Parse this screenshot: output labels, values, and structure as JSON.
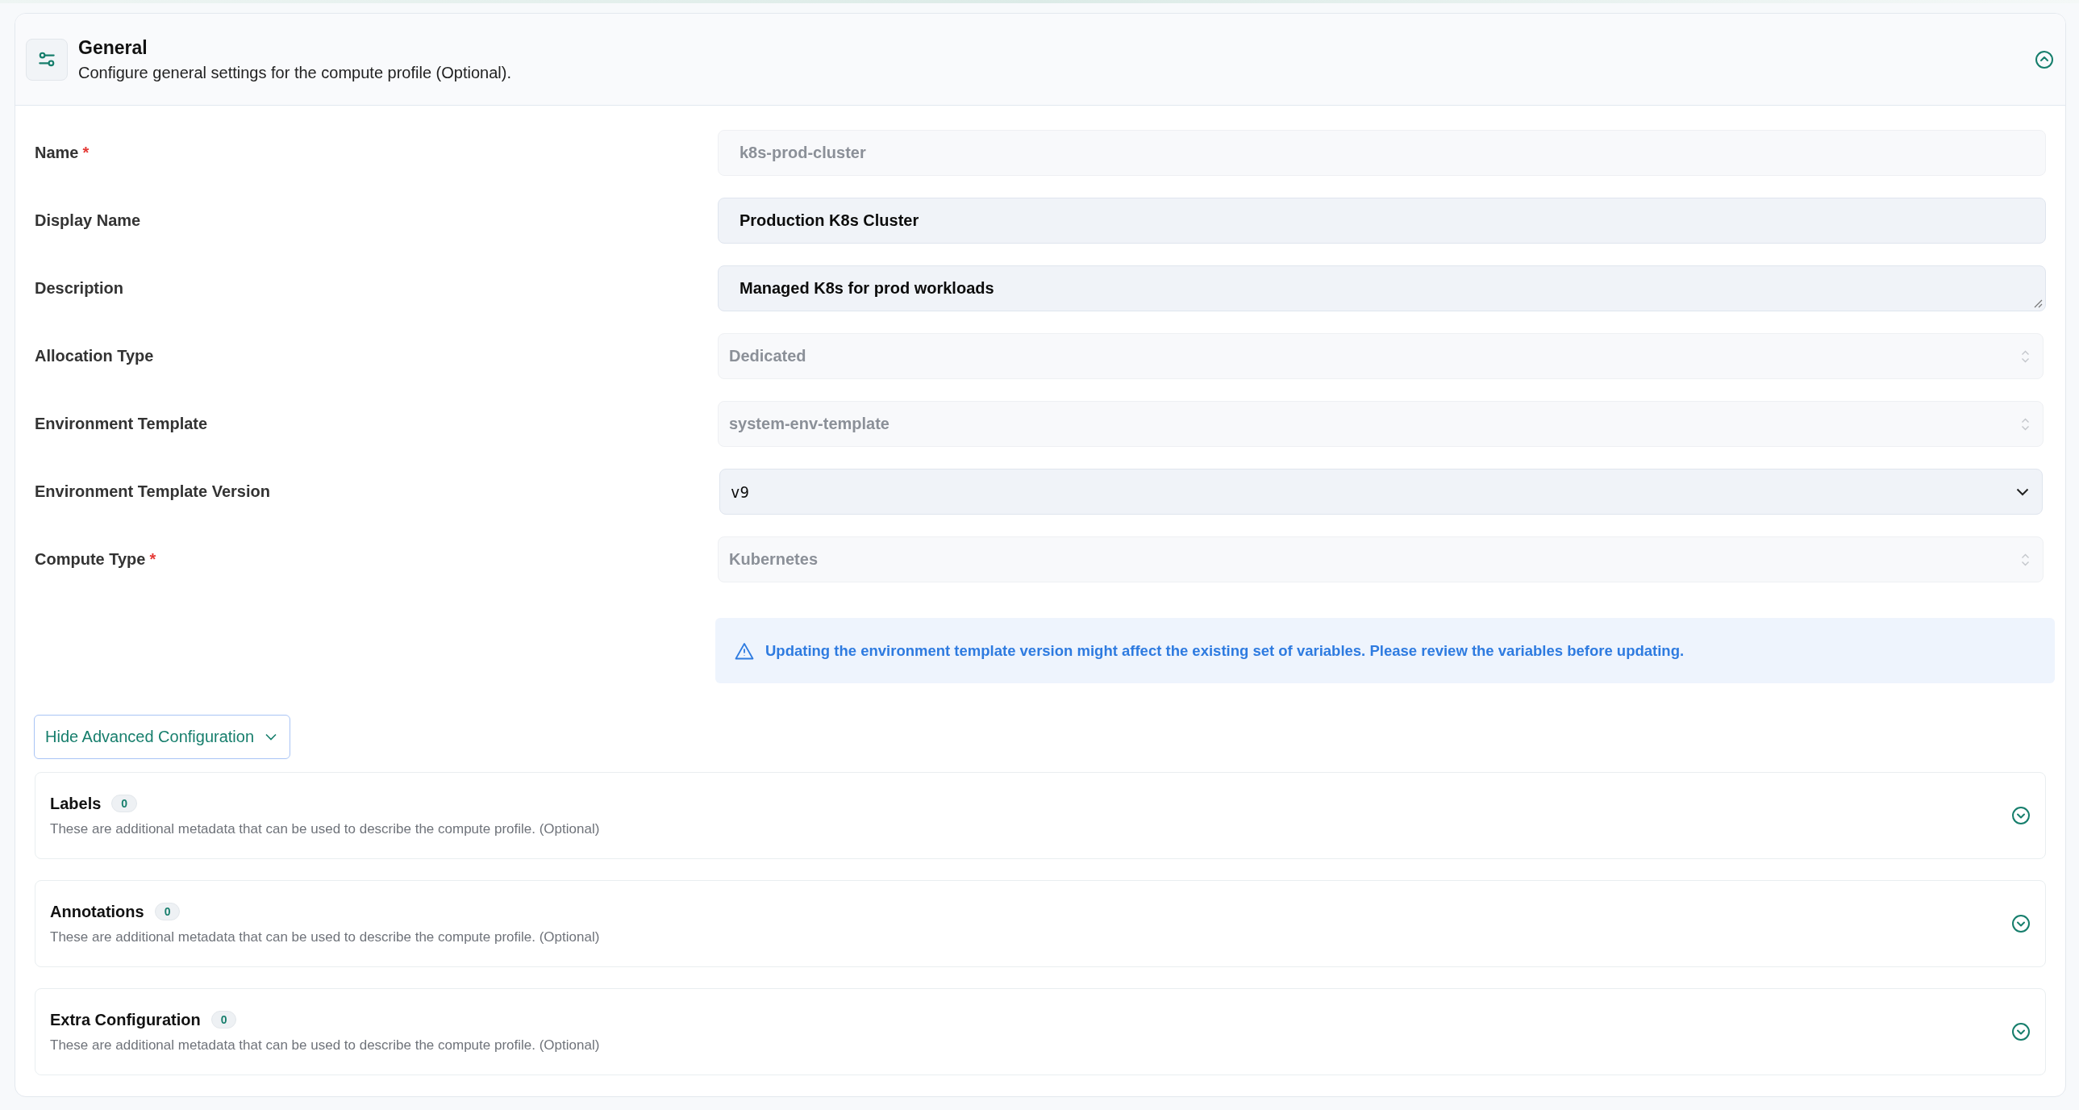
{
  "header": {
    "title": "General",
    "subtitle": "Configure general settings for the compute profile (Optional).",
    "expanded": true
  },
  "fields": [
    {
      "label": "Name",
      "required_mark": "*",
      "kind": "text",
      "value": "k8s-prod-cluster",
      "disabled": true
    },
    {
      "label": "Display Name",
      "kind": "text",
      "value": "Production K8s Cluster",
      "disabled": false
    },
    {
      "label": "Description",
      "kind": "textarea",
      "value": "Managed K8s for prod workloads",
      "disabled": false
    },
    {
      "label": "Allocation Type",
      "kind": "select",
      "value": "Dedicated",
      "disabled": true
    },
    {
      "label": "Environment Template",
      "kind": "select",
      "value": "system-env-template",
      "disabled": true
    },
    {
      "label": "Environment Template Version",
      "kind": "select",
      "value": "v9",
      "disabled": false
    },
    {
      "label": "Compute Type",
      "required_mark": "*",
      "kind": "select",
      "value": "Kubernetes",
      "disabled": true
    }
  ],
  "warning": "Updating the environment template version might affect the existing set of variables. Please review the variables before updating.",
  "advanced_toggle": {
    "label": "Hide Advanced Configuration",
    "expanded": true
  },
  "sections": [
    {
      "title": "Labels",
      "count": "0",
      "description": "These are additional metadata that can be used to describe the compute profile. (Optional)",
      "expanded": false
    },
    {
      "title": "Annotations",
      "count": "0",
      "description": "These are additional metadata that can be used to describe the compute profile. (Optional)",
      "expanded": false
    },
    {
      "title": "Extra Configuration",
      "count": "0",
      "description": "These are additional metadata that can be used to describe the compute profile. (Optional)",
      "expanded": false
    }
  ]
}
